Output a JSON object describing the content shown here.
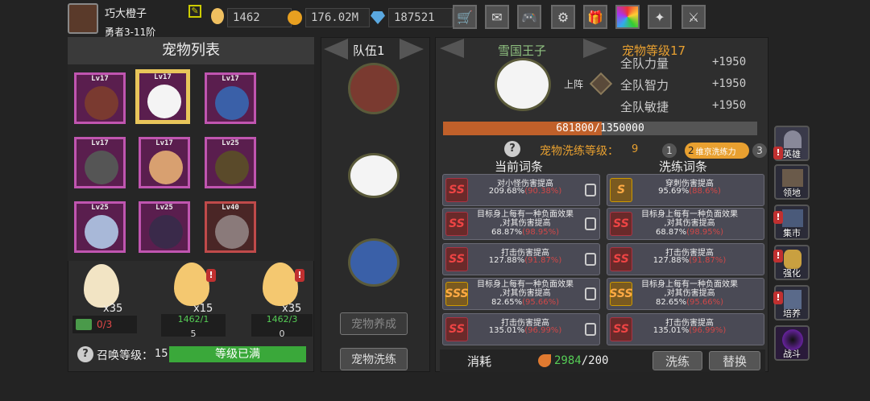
{
  "player": {
    "name": "巧大橙子",
    "rank": "勇者3-11阶"
  },
  "currency": {
    "egg": "1462",
    "coins": "176.02M",
    "gems": "187521"
  },
  "pet_list": {
    "title": "宠物列表",
    "slots": [
      {
        "lv": "Lv17",
        "color": "purple"
      },
      {
        "lv": "Lv17",
        "color": "purple",
        "selected": true
      },
      {
        "lv": "Lv17",
        "color": "purple"
      },
      {
        "lv": "Lv17",
        "color": "purple"
      },
      {
        "lv": "Lv17",
        "color": "purple"
      },
      {
        "lv": "Lv25",
        "color": "purple"
      },
      {
        "lv": "Lv25",
        "color": "purple"
      },
      {
        "lv": "Lv25",
        "color": "purple"
      },
      {
        "lv": "Lv40",
        "color": "red"
      }
    ]
  },
  "eggs": [
    {
      "count": "x35",
      "progress": "0/3",
      "sub": ""
    },
    {
      "count": "x15",
      "progress": "1462/1",
      "sub": "5"
    },
    {
      "count": "x35",
      "progress": "1462/3",
      "sub": "0"
    }
  ],
  "summon": {
    "label": "召唤等级：",
    "level": "15",
    "bar": "等级已满"
  },
  "team": {
    "title": "队伍1",
    "btn_train": "宠物养成",
    "btn_wash": "宠物洗练"
  },
  "pet": {
    "name": "雪国王子",
    "level_label": "宠物等级17",
    "deploy": "上阵",
    "stats": [
      {
        "name": "全队力量",
        "val": "+1950"
      },
      {
        "name": "全队智力",
        "val": "+1950"
      },
      {
        "name": "全队敏捷",
        "val": "+1950"
      }
    ],
    "exp": "681800/1350000",
    "exp_ratio": 0.505
  },
  "wash": {
    "level_label": "宠物洗练等级：",
    "level": "9",
    "tabs": [
      "1",
      "2",
      "3"
    ],
    "tab2_label": "维京洗练力",
    "current_title": "当前词条",
    "new_title": "洗练词条",
    "current": [
      {
        "lines": [
          "对小怪伤害提高"
        ],
        "val": "209.68%",
        "max": "(90.38%)",
        "icon": "SS"
      },
      {
        "lines": [
          "目标身上每有一种负面效果",
          ",对其伤害提高"
        ],
        "val": "68.87%",
        "max": "(98.95%)",
        "icon": "SS"
      },
      {
        "lines": [
          "打击伤害提高"
        ],
        "val": "127.88%",
        "max": "(91.87%)",
        "icon": "SS"
      },
      {
        "lines": [
          "目标身上每有一种负面效果",
          ",对其伤害提高"
        ],
        "val": "82.65%",
        "max": "(95.66%)",
        "icon": "SSS"
      },
      {
        "lines": [
          "打击伤害提高"
        ],
        "val": "135.01%",
        "max": "(96.99%)",
        "icon": "SS"
      }
    ],
    "new": [
      {
        "lines": [
          "穿刺伤害提高"
        ],
        "val": "95.69%",
        "max": "(88.6%)",
        "icon": "S"
      },
      {
        "lines": [
          "目标身上每有一种负面效果",
          ",对其伤害提高"
        ],
        "val": "68.87%",
        "max": "(98.95%)",
        "icon": "SS"
      },
      {
        "lines": [
          "打击伤害提高"
        ],
        "val": "127.88%",
        "max": "(91.87%)",
        "icon": "SS"
      },
      {
        "lines": [
          "目标身上每有一种负面效果",
          ",对其伤害提高"
        ],
        "val": "82.65%",
        "max": "(95.66%)",
        "icon": "SSS"
      },
      {
        "lines": [
          "打击伤害提高"
        ],
        "val": "135.01%",
        "max": "(96.99%)",
        "icon": "SS"
      }
    ],
    "cost_label": "消耗",
    "cost": "2984",
    "cost_max": "/200",
    "btn_wash": "洗练",
    "btn_replace": "替换"
  },
  "sidebar": [
    {
      "label": "英雄"
    },
    {
      "label": "领地"
    },
    {
      "label": "集市"
    },
    {
      "label": "强化"
    },
    {
      "label": "培养"
    },
    {
      "label": "战斗"
    }
  ]
}
